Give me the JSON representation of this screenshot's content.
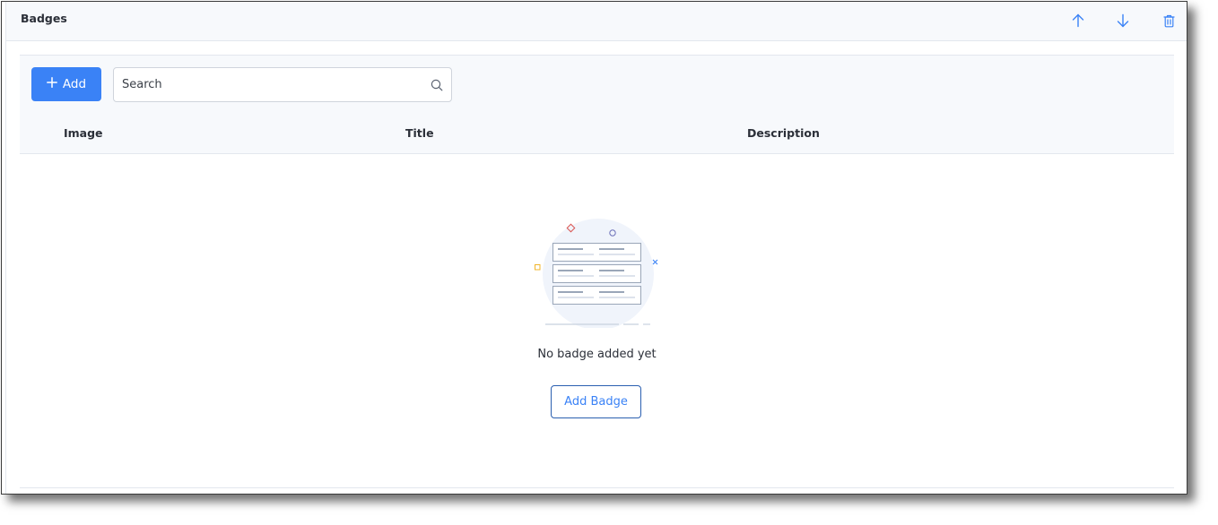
{
  "header": {
    "title": "Badges",
    "icons": [
      "arrow-up-icon",
      "arrow-down-icon",
      "trash-icon"
    ]
  },
  "toolbar": {
    "add_label": "Add",
    "search_placeholder": "Search",
    "search_value": ""
  },
  "table": {
    "columns": [
      "Image",
      "Title",
      "Description"
    ],
    "rows": []
  },
  "empty_state": {
    "message": "No badge added yet",
    "button_label": "Add Badge"
  },
  "colors": {
    "accent": "#3a82f6",
    "header_bg": "#f7f9fc",
    "border": "#e3e7ee"
  }
}
